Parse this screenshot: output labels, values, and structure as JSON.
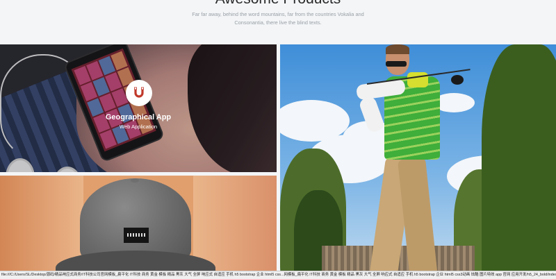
{
  "section": {
    "title": "Awesome Products",
    "subtitle": "Far far away, behind the word mountains, far from the countries Vokalia and Consonantia, there live the blind texts."
  },
  "tiles": [
    {
      "title": "Geographical App",
      "subtitle": "Web Application",
      "icon": "magnet-icon",
      "image": "phone-in-hand"
    },
    {
      "image": "baseball-cap"
    },
    {
      "image": "golfer-swinging"
    }
  ],
  "status_bar": {
    "url": "file:///C:/Users/SL/Desktop/源码/精品响应式商务/IT科技公司官网模板_扁平化 IT科技 商务 黄金 模板 精品 黑灰 大气 全屏 响应式 自适应 手机 h5 bootstrap 企业 html5 css...网模板_扁平化 IT科技 商务 黄金 模板 精品 黑灰 大气 全屏 响应式 自适应 手机 h5 bootstrap 企业 html5 css3动画 炫酷 图片特效 app 官网 应用开发/h5_24_bold/index.html#"
  },
  "colors": {
    "page_background": "#f3f5f7",
    "title": "#2b2b2b",
    "subtitle": "#9aa0a6",
    "badge_icon": "#c0392b"
  }
}
